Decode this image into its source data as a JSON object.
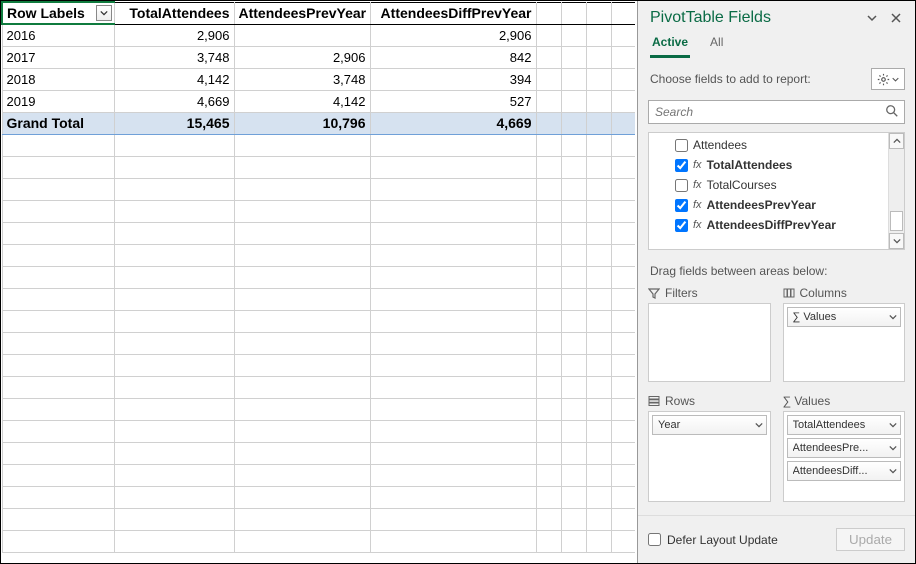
{
  "table": {
    "headers": [
      "Row Labels",
      "TotalAttendees",
      "AttendeesPrevYear",
      "AttendeesDiffPrevYear"
    ],
    "rows": [
      {
        "label": "2016",
        "total": "2,906",
        "prev": "",
        "diff": "2,906"
      },
      {
        "label": "2017",
        "total": "3,748",
        "prev": "2,906",
        "diff": "842"
      },
      {
        "label": "2018",
        "total": "4,142",
        "prev": "3,748",
        "diff": "394"
      },
      {
        "label": "2019",
        "total": "4,669",
        "prev": "4,142",
        "diff": "527"
      }
    ],
    "grand_total": {
      "label": "Grand Total",
      "total": "15,465",
      "prev": "10,796",
      "diff": "4,669"
    }
  },
  "pane": {
    "title": "PivotTable Fields",
    "tabs": {
      "active": "Active",
      "all": "All"
    },
    "choose_label": "Choose fields to add to report:",
    "search_placeholder": "Search",
    "fields": [
      {
        "name": "Attendees",
        "checked": false,
        "fx": false
      },
      {
        "name": "TotalAttendees",
        "checked": true,
        "fx": true
      },
      {
        "name": "TotalCourses",
        "checked": false,
        "fx": true
      },
      {
        "name": "AttendeesPrevYear",
        "checked": true,
        "fx": true
      },
      {
        "name": "AttendeesDiffPrevYear",
        "checked": true,
        "fx": true
      }
    ],
    "drag_label": "Drag fields between areas below:",
    "areas": {
      "filters": {
        "label": "Filters",
        "chips": []
      },
      "columns": {
        "label": "Columns",
        "chips": [
          "∑ Values"
        ]
      },
      "rows": {
        "label": "Rows",
        "chips": [
          "Year"
        ]
      },
      "values": {
        "label": "∑ Values",
        "chips": [
          "TotalAttendees",
          "AttendeesPre...",
          "AttendeesDiff..."
        ]
      }
    },
    "defer_label": "Defer Layout Update",
    "update_label": "Update"
  }
}
